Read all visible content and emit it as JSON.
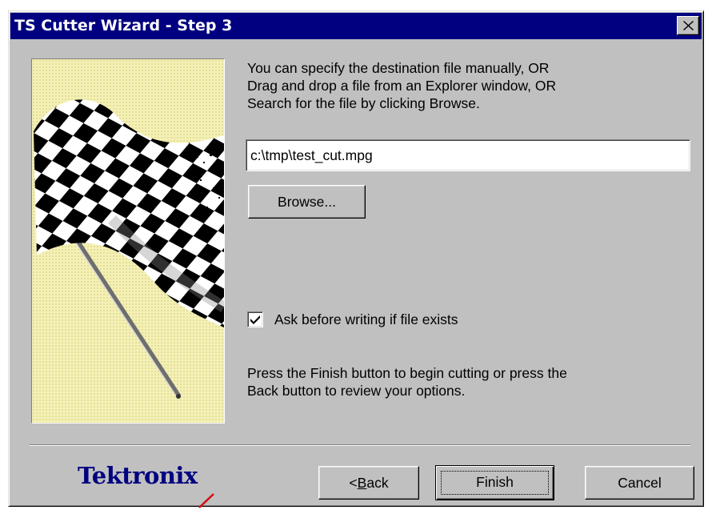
{
  "window": {
    "title": "TS Cutter Wizard - Step 3",
    "colors": {
      "titlebar": "#000080",
      "face": "#c0c0c0",
      "logo": "#000080",
      "logo_accent": "#d01010"
    }
  },
  "instructions": {
    "line1": "You can specify the destination file manually, OR",
    "line2": "Drag and drop a file from an Explorer window, OR",
    "line3": "Search for the file by clicking Browse."
  },
  "destination": {
    "value": "c:\\tmp\\test_cut.mpg"
  },
  "buttons": {
    "browse": "Browse...",
    "back_prefix": "< ",
    "back_mnemonic": "B",
    "back_rest": "ack",
    "finish": "Finish",
    "cancel": "Cancel"
  },
  "options": {
    "ask_before_overwrite": {
      "label": "Ask before writing if file exists",
      "checked": true
    }
  },
  "footer_note": {
    "line1": "Press the Finish button to begin cutting or press the",
    "line2": "Back button to review your options."
  },
  "brand": {
    "logo_text": "Tektronix"
  },
  "icons": {
    "close": "close-icon",
    "art": "checkered-flag-icon",
    "check": "checkmark-icon"
  }
}
